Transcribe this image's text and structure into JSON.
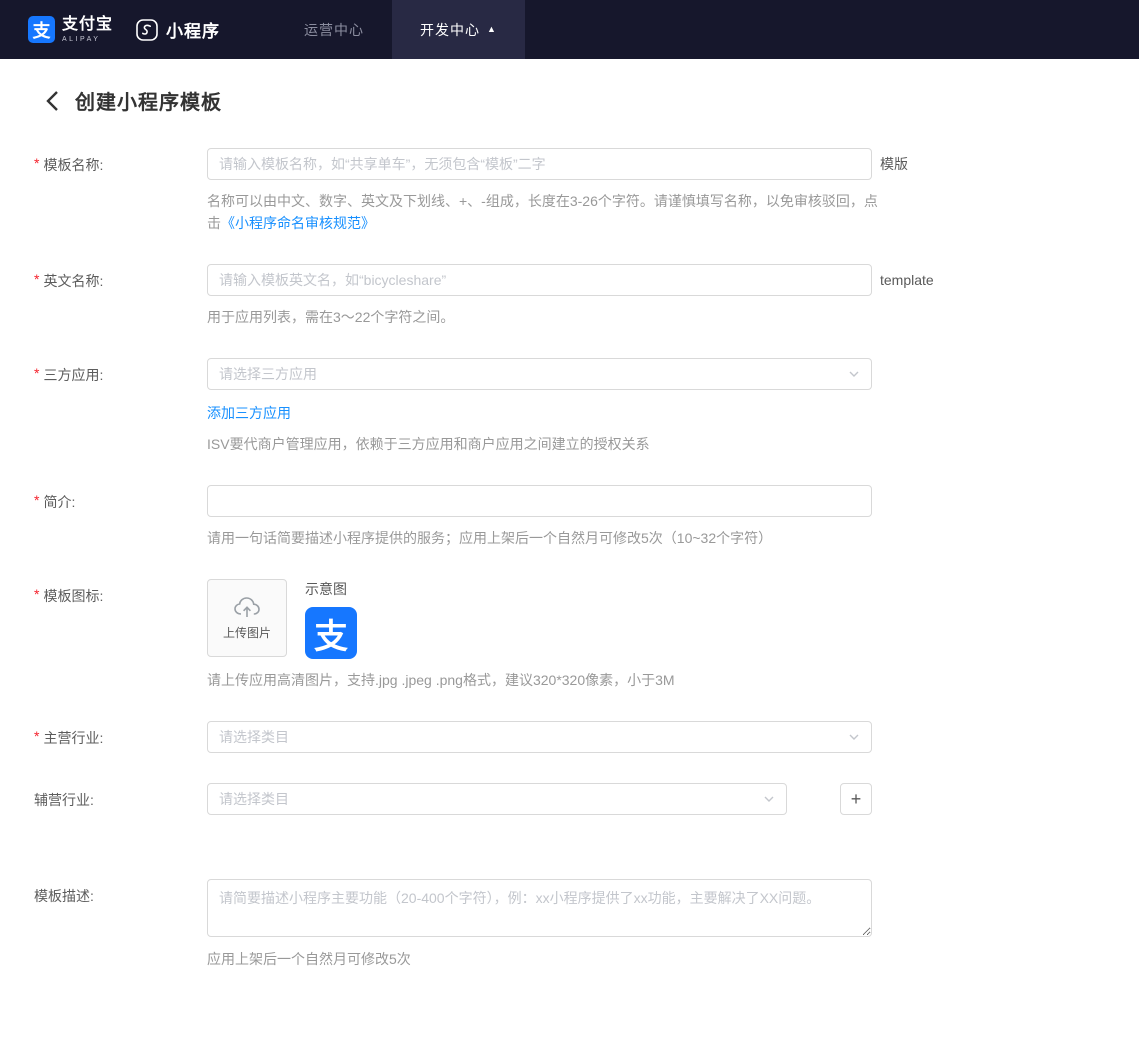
{
  "colors": {
    "navbar_bg": "#16172c",
    "active_tab_bg": "#282944",
    "link_blue": "#1890ff",
    "required_red": "#f5222d",
    "alipay_blue": "#1677ff"
  },
  "navbar": {
    "brand": {
      "alipay_cn": "支付宝",
      "alipay_en": "ALIPAY",
      "alipay_glyph": "支",
      "product": "小程序"
    },
    "items": [
      {
        "label": "运营中心",
        "active": false
      },
      {
        "label": "开发中心",
        "active": true,
        "caret": "▲"
      }
    ]
  },
  "page": {
    "title": "创建小程序模板"
  },
  "form": {
    "required_mark": "*",
    "template_name": {
      "label": "模板名称:",
      "placeholder": "请输入模板名称，如“共享单车”，无须包含“模板”二字",
      "suffix": "模版",
      "help": "名称可以由中文、数字、英文及下划线、+、-组成，长度在3-26个字符。请谨慎填写名称，以免审核驳回，点击",
      "help_link": "《小程序命名审核规范》"
    },
    "english_name": {
      "label": "英文名称:",
      "placeholder": "请输入模板英文名，如“bicycleshare”",
      "suffix": "template",
      "help": "用于应用列表，需在3～22个字符之间。"
    },
    "third_party_app": {
      "label": "三方应用:",
      "placeholder": "请选择三方应用",
      "add_link": "添加三方应用",
      "help": "ISV要代商户管理应用，依赖于三方应用和商户应用之间建立的授权关系"
    },
    "intro": {
      "label": "简介:",
      "value": "",
      "help": "请用一句话简要描述小程序提供的服务；应用上架后一个自然月可修改5次（10~32个字符）"
    },
    "template_icon": {
      "label": "模板图标:",
      "upload_label": "上传图片",
      "sample_label": "示意图",
      "sample_glyph": "支",
      "help": "请上传应用高清图片，支持.jpg .jpeg .png格式，建议320*320像素，小于3M"
    },
    "main_industry": {
      "label": "主营行业:",
      "placeholder": "请选择类目"
    },
    "secondary_industry": {
      "label": "辅营行业:",
      "placeholder": "请选择类目",
      "add_button": "+"
    },
    "template_desc": {
      "label": "模板描述:",
      "placeholder": "请简要描述小程序主要功能（20-400个字符），例：xx小程序提供了xx功能，主要解决了XX问题。",
      "help": "应用上架后一个自然月可修改5次"
    }
  }
}
